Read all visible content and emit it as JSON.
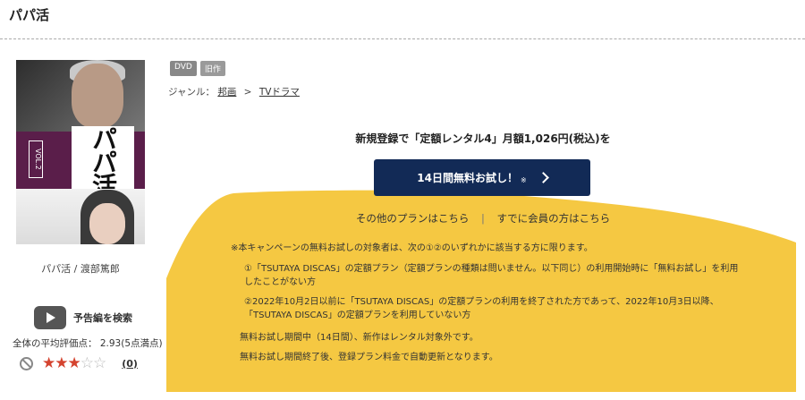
{
  "page": {
    "title": "パパ活"
  },
  "item": {
    "cover_title": "パパ活",
    "cover_vol": "VOL.2",
    "caption": "パパ活 / 渡部篤郎",
    "trailer_label": "予告編を検索",
    "average_rating": "全体の平均評価点： 2.93(5点満点)",
    "stars": {
      "filled": 3,
      "total": 5
    },
    "review_count": "(0)"
  },
  "tags": [
    "DVD",
    "旧作"
  ],
  "breadcrumb": {
    "prefix": "ジャンル：",
    "items": [
      "邦画",
      "TVドラマ"
    ],
    "separator": ">"
  },
  "promo": {
    "headline": "新規登録で「定額レンタル4」月額1,026円(税込)を",
    "button_label": "14日間無料お試し！",
    "button_mark": "※",
    "other_plans": "その他のプランはこちら",
    "members": "すでに会員の方はこちら",
    "link_separator": "|",
    "notes": [
      "※本キャンペーンの無料お試しの対象者は、次の①②のいずれかに該当する方に限ります。",
      "①「TSUTAYA DISCAS」の定額プラン（定額プランの種類は問いません。以下同じ）の利用開始時に「無料お試し」を利用したことがない方",
      "②2022年10月2日以前に「TSUTAYA DISCAS」の定額プランの利用を終了された方であって、2022年10月3日以降、「TSUTAYA DISCAS」の定額プランを利用していない方",
      "無料お試し期間中（14日間）、新作はレンタル対象外です。",
      "無料お試し期間終了後、登録プラン料金で自動更新となります。"
    ],
    "colors": {
      "background": "#f5c842",
      "button": "#122a56"
    }
  }
}
